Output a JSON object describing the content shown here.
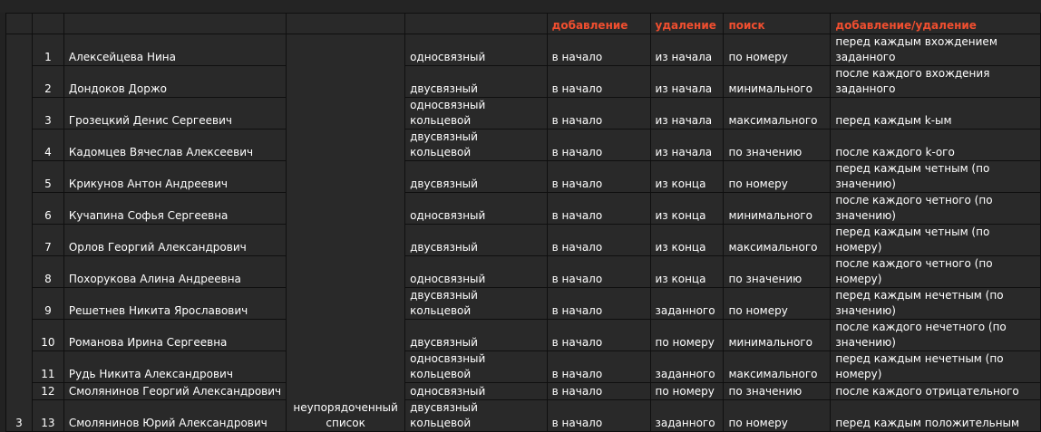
{
  "headers": {
    "col_add": "добавление",
    "col_del": "удаление",
    "col_search": "поиск",
    "col_adddel": "добавление/удаление"
  },
  "group_number": "3",
  "list_type": "неупорядоченный список",
  "rows": [
    {
      "n": "1",
      "name": "Алексейцева Нина",
      "structure": "односвязный",
      "add": "в начало",
      "del": "из начала",
      "search": "по номеру",
      "adddel": "перед каждым вхождением заданного"
    },
    {
      "n": "2",
      "name": "Дондоков Доржо",
      "structure": "двусвязный",
      "add": "в начало",
      "del": "из начала",
      "search": "минимального",
      "adddel": "после каждого вхождения заданного"
    },
    {
      "n": "3",
      "name": "Грозецкий Денис Сергеевич",
      "structure": "односвязный кольцевой",
      "add": "в начало",
      "del": "из начала",
      "search": "максимального",
      "adddel": "перед каждым k-ым"
    },
    {
      "n": "4",
      "name": "Кадомцев Вячеслав Алексеевич",
      "structure": "двусвязный кольцевой",
      "add": "в начало",
      "del": "из начала",
      "search": "по значению",
      "adddel": "после каждого k-ого"
    },
    {
      "n": "5",
      "name": "Крикунов Антон Андреевич",
      "structure": "двусвязный",
      "add": "в начало",
      "del": "из конца",
      "search": "по номеру",
      "adddel": "перед каждым четным (по значению)"
    },
    {
      "n": "6",
      "name": "Кучапина Софья Сергеевна",
      "structure": "односвязный",
      "add": "в начало",
      "del": "из конца",
      "search": "минимального",
      "adddel": "после каждого четного (по значению)"
    },
    {
      "n": "7",
      "name": "Орлов Георгий Александрович",
      "structure": "двусвязный",
      "add": "в начало",
      "del": "из конца",
      "search": "максимального",
      "adddel": "перед каждым четным (по номеру)"
    },
    {
      "n": "8",
      "name": "Похорукова Алина Андреевна",
      "structure": "односвязный",
      "add": "в начало",
      "del": "из конца",
      "search": "по значению",
      "adddel": "после каждого четного (по номеру)"
    },
    {
      "n": "9",
      "name": "Решетнев Никита Ярославович",
      "structure": "двусвязный кольцевой",
      "add": "в начало",
      "del": "заданного",
      "search": "по номеру",
      "adddel": "перед каждым нечетным (по значению)"
    },
    {
      "n": "10",
      "name": "Романова Ирина Сергеевна",
      "structure": "двусвязный",
      "add": "в начало",
      "del": "по номеру",
      "search": "минимального",
      "adddel": "после каждого нечетного (по значению)"
    },
    {
      "n": "11",
      "name": "Рудь Никита Александрович",
      "structure": "односвязный кольцевой",
      "add": "в начало",
      "del": "заданного",
      "search": "максимального",
      "adddel": "перед каждым нечетным (по номеру)"
    },
    {
      "n": "12",
      "name": "Смолянинов Георгий Александрович",
      "structure": "односвязный",
      "add": "в начало",
      "del": "по номеру",
      "search": "по значению",
      "adddel": "после каждого отрицательного"
    },
    {
      "n": "13",
      "name": "Смолянинов Юрий Александрович",
      "structure": "двусвязный кольцевой",
      "add": "в начало",
      "del": "заданного",
      "search": "по номеру",
      "adddel": "перед каждым положительным"
    }
  ],
  "colors": {
    "background": "#222222",
    "cell": "#292929",
    "header_text": "#f04e2f",
    "text": "#ffffff"
  }
}
